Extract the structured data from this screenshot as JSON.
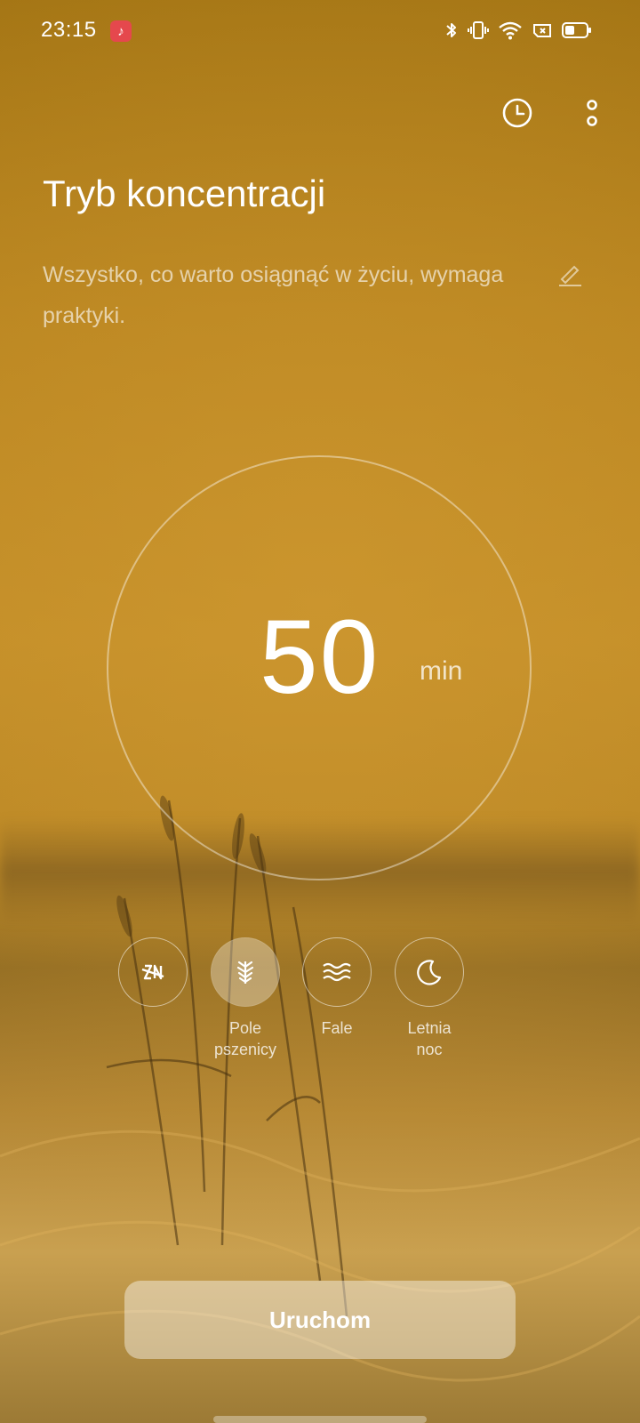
{
  "status_bar": {
    "time": "23:15",
    "notification_icon": "music-note-icon",
    "icons": [
      "bluetooth-icon",
      "vibrate-icon",
      "wifi-icon",
      "no-sim-icon",
      "battery-icon"
    ]
  },
  "header": {
    "history_icon": "clock-icon",
    "more_icon": "more-vertical-icon"
  },
  "title": "Tryb koncentracji",
  "quote": "Wszystko, co warto osiągnąć w życiu, wymaga praktyki.",
  "edit_icon": "pencil-icon",
  "timer": {
    "value": "50",
    "unit": "min"
  },
  "sounds": [
    {
      "icon": "no-sound-icon",
      "label": "",
      "active": false
    },
    {
      "icon": "wheat-icon",
      "label": "Pole\npszenicy",
      "active": true
    },
    {
      "icon": "waves-icon",
      "label": "Fale",
      "active": false
    },
    {
      "icon": "moon-icon",
      "label": "Letnia\nnoc",
      "active": false
    }
  ],
  "start_button": "Uruchom",
  "colors": {
    "accent": "#c28d27",
    "badge": "#e5484d"
  }
}
